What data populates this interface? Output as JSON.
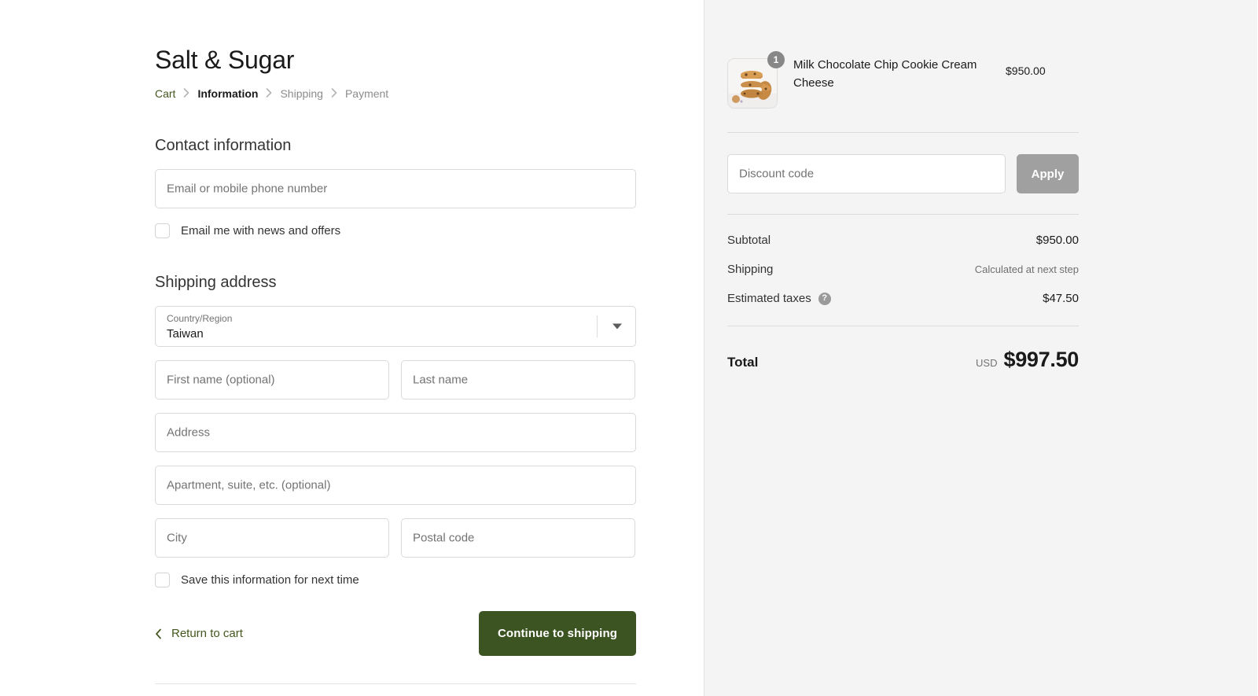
{
  "shop": {
    "name": "Salt & Sugar"
  },
  "breadcrumb": {
    "items": [
      {
        "label": "Cart",
        "state": "link"
      },
      {
        "label": "Information",
        "state": "current"
      },
      {
        "label": "Shipping",
        "state": "upcoming"
      },
      {
        "label": "Payment",
        "state": "upcoming"
      }
    ],
    "separator_icon": "chevron-right-icon"
  },
  "contact": {
    "heading": "Contact information",
    "email_placeholder": "Email or mobile phone number",
    "email_value": "",
    "newsletter_label": "Email me with news and offers",
    "newsletter_checked": false
  },
  "shipping_address": {
    "heading": "Shipping address",
    "country": {
      "label": "Country/Region",
      "value": "Taiwan",
      "caret_icon": "chevron-down-icon"
    },
    "first_name_placeholder": "First name (optional)",
    "first_name_value": "",
    "last_name_placeholder": "Last name",
    "last_name_value": "",
    "address_placeholder": "Address",
    "address_value": "",
    "apartment_placeholder": "Apartment, suite, etc. (optional)",
    "apartment_value": "",
    "city_placeholder": "City",
    "city_value": "",
    "postal_placeholder": "Postal code",
    "postal_value": "",
    "save_info_label": "Save this information for next time",
    "save_info_checked": false
  },
  "actions": {
    "return_label": "Return to cart",
    "return_icon": "chevron-left-icon",
    "continue_label": "Continue to shipping"
  },
  "order_summary": {
    "items": [
      {
        "title": "Milk Chocolate Chip Cookie Cream Cheese",
        "quantity": "1",
        "price": "$950.00",
        "image_icon": "cookie-sandwich-stack-photo"
      }
    ],
    "discount": {
      "placeholder": "Discount code",
      "value": "",
      "apply_label": "Apply"
    },
    "lines": [
      {
        "label": "Subtotal",
        "value": "$950.00",
        "muted": false,
        "help": false
      },
      {
        "label": "Shipping",
        "value": "Calculated at next step",
        "muted": true,
        "help": false
      },
      {
        "label": "Estimated taxes",
        "value": "$47.50",
        "muted": false,
        "help": true,
        "help_icon": "question-mark-icon"
      }
    ],
    "total": {
      "label": "Total",
      "currency": "USD",
      "amount": "$997.50"
    }
  },
  "colors": {
    "accent_green": "#44571f",
    "cta_green": "#3c5322",
    "summary_bg": "#f4f4f4",
    "apply_gray": "#a0a0a0"
  }
}
